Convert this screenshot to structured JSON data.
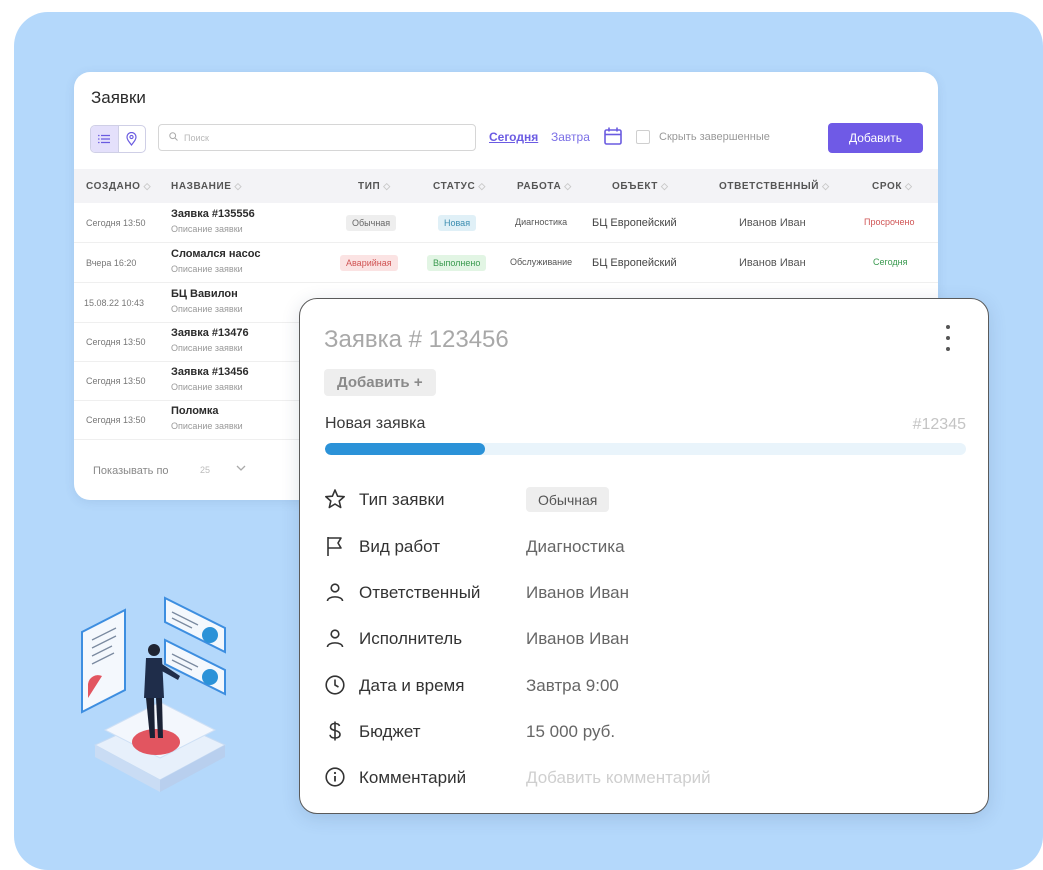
{
  "list": {
    "title": "Заявки",
    "search_placeholder": "Поиск",
    "today_link": "Сегодня",
    "tomorrow_link": "Завтра",
    "hide_completed_label": "Скрыть завершенные",
    "add_button": "Добавить",
    "columns": [
      "СОЗДАНО",
      "НАЗВАНИЕ",
      "ТИП",
      "СТАТУС",
      "РАБОТА",
      "ОБЪЕКТ",
      "ОТВЕТСТВЕННЫЙ",
      "СРОК"
    ],
    "rows": [
      {
        "created": "Сегодня 13:50",
        "name": "Заявка #135556",
        "desc": "Описание заявки",
        "type": "Обычная",
        "status": "Новая",
        "work": "Диагностика",
        "object": "БЦ Европейский",
        "responsible": "Иванов Иван",
        "due": "Просрочено"
      },
      {
        "created": "Вчера 16:20",
        "name": "Сломался насос",
        "desc": "Описание заявки",
        "type": "Аварийная",
        "status": "Выполнено",
        "work": "Обслуживание",
        "object": "БЦ Европейский",
        "responsible": "Иванов Иван",
        "due": "Сегодня"
      },
      {
        "created": "15.08.22 10:43",
        "name": "БЦ Вавилон",
        "desc": "Описание заявки"
      },
      {
        "created": "Сегодня 13:50",
        "name": "Заявка #13476",
        "desc": "Описание заявки"
      },
      {
        "created": "Сегодня 13:50",
        "name": "Заявка #13456",
        "desc": "Описание заявки"
      },
      {
        "created": "Сегодня 13:50",
        "name": "Поломка",
        "desc": "Описание заявки"
      }
    ],
    "show_per_page_label": "Показывать по",
    "show_per_page_value": "25"
  },
  "card": {
    "title": "Заявка # 123456",
    "add_tag": "Добавить +",
    "stage_label": "Новая заявка",
    "stage_id": "#12345",
    "progress": 0.25,
    "fields": [
      {
        "icon": "star-icon",
        "label": "Тип заявки",
        "value": "Обычная",
        "badge": true
      },
      {
        "icon": "flag-icon",
        "label": "Вид работ",
        "value": "Диагностика"
      },
      {
        "icon": "user-icon",
        "label": "Ответственный",
        "value": "Иванов Иван"
      },
      {
        "icon": "user-icon",
        "label": "Исполнитель",
        "value": "Иванов Иван"
      },
      {
        "icon": "clock-icon",
        "label": "Дата и время",
        "value": "Завтра 9:00"
      },
      {
        "icon": "dollar-icon",
        "label": "Бюджет",
        "value": "15 000 руб."
      },
      {
        "icon": "info-icon",
        "label": "Комментарий",
        "value": "Добавить комментарий",
        "placeholder": true
      }
    ]
  },
  "colors": {
    "accent": "#6f5ae6",
    "progress": "#2b92d8",
    "background": "#b4d8fb",
    "overdue": "#d05555",
    "today": "#3a9a4f"
  }
}
